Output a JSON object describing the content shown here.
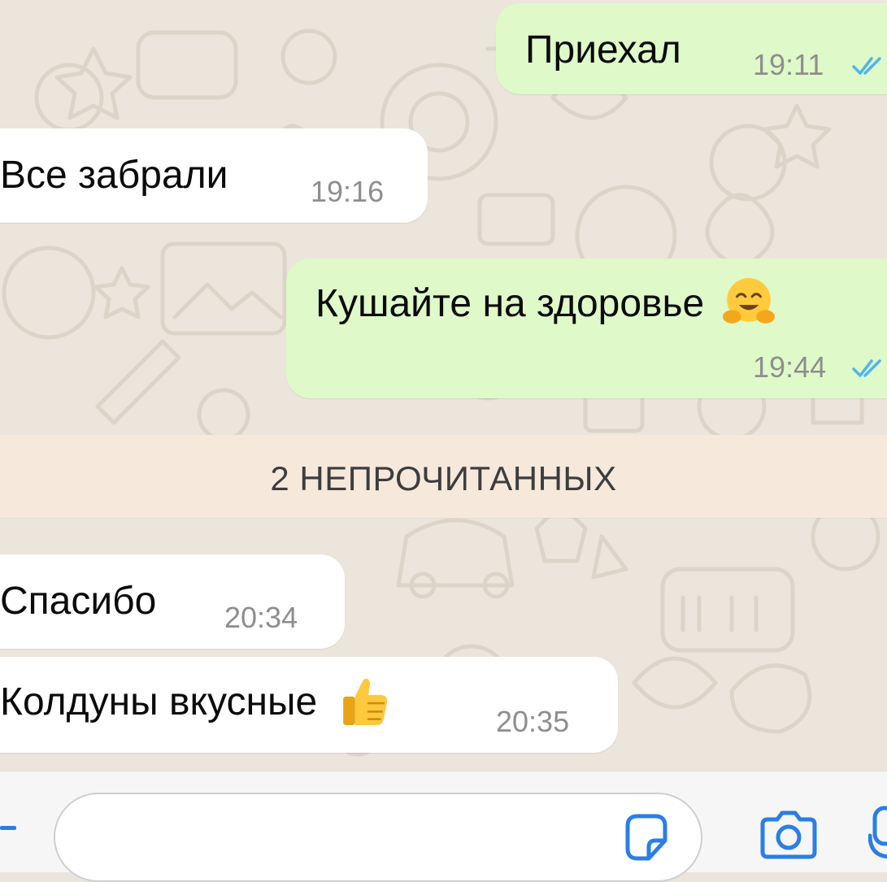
{
  "messages": [
    {
      "direction": "outgoing",
      "text": "Приехал",
      "time": "19:11",
      "status": "read"
    },
    {
      "direction": "incoming",
      "text": "Все забрали",
      "time": "19:16"
    },
    {
      "direction": "outgoing",
      "text": "Кушайте на здоровье",
      "emoji": "hugging-face-emoji",
      "time": "19:44",
      "status": "read"
    },
    {
      "direction": "incoming",
      "text": "Спасибо",
      "time": "20:34"
    },
    {
      "direction": "incoming",
      "text": "Колдуны вкусные",
      "emoji": "thumbs-up-emoji",
      "time": "20:35"
    }
  ],
  "unread_divider": "2 НЕПРОЧИТАННЫХ",
  "composer": {
    "value": "",
    "icons": [
      "plus-icon",
      "sticker-icon",
      "camera-icon",
      "microphone-icon"
    ]
  },
  "colors": {
    "outgoing_bubble": "#dff9c9",
    "incoming_bubble": "#ffffff",
    "accent": "#2a7ee6",
    "read_ticks": "#4fb6ec",
    "chat_background": "#ece5dc"
  }
}
